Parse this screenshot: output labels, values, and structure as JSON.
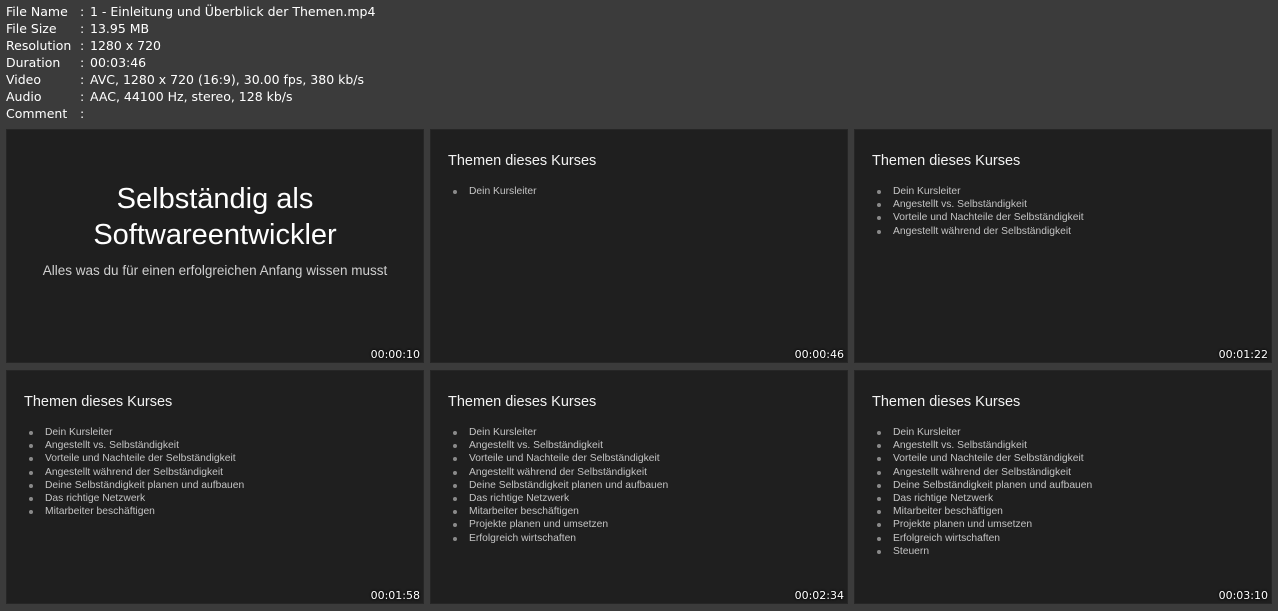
{
  "file_info": [
    {
      "label": "File Name",
      "value": "1 - Einleitung und Überblick der Themen.mp4"
    },
    {
      "label": "File Size",
      "value": "13.95 MB"
    },
    {
      "label": "Resolution",
      "value": "1280 x 720"
    },
    {
      "label": "Duration",
      "value": "00:03:46"
    },
    {
      "label": "Video",
      "value": "AVC, 1280 x 720 (16:9), 30.00 fps, 380 kb/s"
    },
    {
      "label": "Audio",
      "value": "AAC, 44100 Hz, stereo, 128 kb/s"
    },
    {
      "label": "Comment",
      "value": ""
    }
  ],
  "separator": ":",
  "thumbnails": [
    {
      "timestamp": "00:00:10",
      "title_line1": "Selbständig als",
      "title_line2": "Softwareentwickler",
      "subtitle": "Alles was du für einen erfolgreichen Anfang wissen musst"
    },
    {
      "timestamp": "00:00:46",
      "heading": "Themen dieses Kurses",
      "bullets": [
        "Dein Kursleiter"
      ]
    },
    {
      "timestamp": "00:01:22",
      "heading": "Themen dieses Kurses",
      "bullets": [
        "Dein Kursleiter",
        "Angestellt vs. Selbständigkeit",
        "Vorteile und Nachteile der Selbständigkeit",
        "Angestellt während der Selbständigkeit"
      ]
    },
    {
      "timestamp": "00:01:58",
      "heading": "Themen dieses Kurses",
      "bullets": [
        "Dein Kursleiter",
        "Angestellt vs. Selbständigkeit",
        "Vorteile und Nachteile der Selbständigkeit",
        "Angestellt während der Selbständigkeit",
        "Deine Selbständigkeit planen und aufbauen",
        "Das richtige Netzwerk",
        "Mitarbeiter beschäftigen"
      ]
    },
    {
      "timestamp": "00:02:34",
      "heading": "Themen dieses Kurses",
      "bullets": [
        "Dein Kursleiter",
        "Angestellt vs. Selbständigkeit",
        "Vorteile und Nachteile der Selbständigkeit",
        "Angestellt während der Selbständigkeit",
        "Deine Selbständigkeit planen und aufbauen",
        "Das richtige Netzwerk",
        "Mitarbeiter beschäftigen",
        "Projekte planen und umsetzen",
        "Erfolgreich wirtschaften"
      ]
    },
    {
      "timestamp": "00:03:10",
      "heading": "Themen dieses Kurses",
      "bullets": [
        "Dein Kursleiter",
        "Angestellt vs. Selbständigkeit",
        "Vorteile und Nachteile der Selbständigkeit",
        "Angestellt während der Selbständigkeit",
        "Deine Selbständigkeit planen und aufbauen",
        "Das richtige Netzwerk",
        "Mitarbeiter beschäftigen",
        "Projekte planen und umsetzen",
        "Erfolgreich wirtschaften",
        "Steuern"
      ]
    }
  ],
  "colors": {
    "background": "#3b3b3b",
    "frame": "#1f1f1f",
    "text": "#ffffff",
    "bullet_text": "#c4c4c4"
  }
}
